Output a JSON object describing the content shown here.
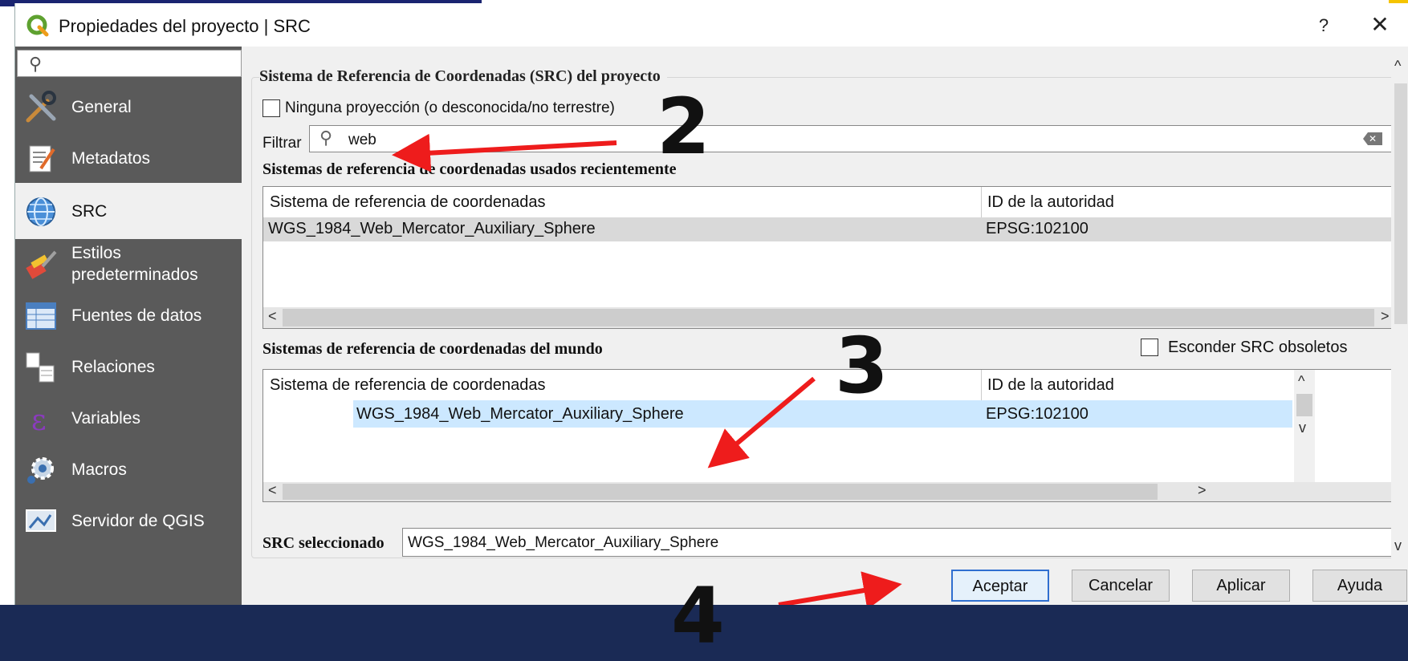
{
  "window": {
    "title": "Propiedades del proyecto | SRC",
    "help_label": "?",
    "close_label": "✕"
  },
  "sidebar": {
    "search_placeholder": "",
    "items": [
      {
        "label": "General",
        "icon": "tools-icon"
      },
      {
        "label": "Metadatos",
        "icon": "metadata-icon"
      },
      {
        "label": "SRC",
        "icon": "globe-icon",
        "selected": true
      },
      {
        "label": "Estilos predeterminados",
        "icon": "brush-icon"
      },
      {
        "label": "Fuentes de datos",
        "icon": "table-icon"
      },
      {
        "label": "Relaciones",
        "icon": "relations-icon"
      },
      {
        "label": "Variables",
        "icon": "epsilon-icon"
      },
      {
        "label": "Macros",
        "icon": "gear-icon"
      },
      {
        "label": "Servidor de QGIS",
        "icon": "server-map-icon"
      }
    ]
  },
  "main": {
    "group_title": "Sistema de Referencia de Coordenadas (SRC) del proyecto",
    "no_projection_label": "Ninguna proyección (o desconocida/no terrestre)",
    "filter_label": "Filtrar",
    "filter_value": "web",
    "recent_title": "Sistemas de referencia de coordenadas usados recientemente",
    "world_title": "Sistemas de referencia de coordenadas del mundo",
    "hide_deprecated_label": "Esconder SRC obsoletos",
    "recent_table": {
      "headers": [
        "Sistema de referencia de coordenadas",
        "ID de la autoridad"
      ],
      "rows": [
        [
          "WGS_1984_Web_Mercator_Auxiliary_Sphere",
          "EPSG:102100"
        ]
      ]
    },
    "world_table": {
      "headers": [
        "Sistema de referencia de coordenadas",
        "ID de la autoridad"
      ],
      "rows": [
        [
          "WGS_1984_Web_Mercator_Auxiliary_Sphere",
          "EPSG:102100"
        ]
      ]
    },
    "selected_label": "SRC seleccionado",
    "selected_value": "WGS_1984_Web_Mercator_Auxiliary_Sphere"
  },
  "buttons": {
    "ok": "Aceptar",
    "cancel": "Cancelar",
    "apply": "Aplicar",
    "help": "Ayuda"
  },
  "annotations": {
    "step2": "2",
    "step3": "3",
    "step4": "4",
    "arrow_color": "#ee1c1c"
  },
  "colors": {
    "sidebar_bg": "#5a5a5a",
    "selected_row": "#cce8ff",
    "recent_row": "#d9d9d9",
    "default_button_border": "#2f6fd0"
  }
}
